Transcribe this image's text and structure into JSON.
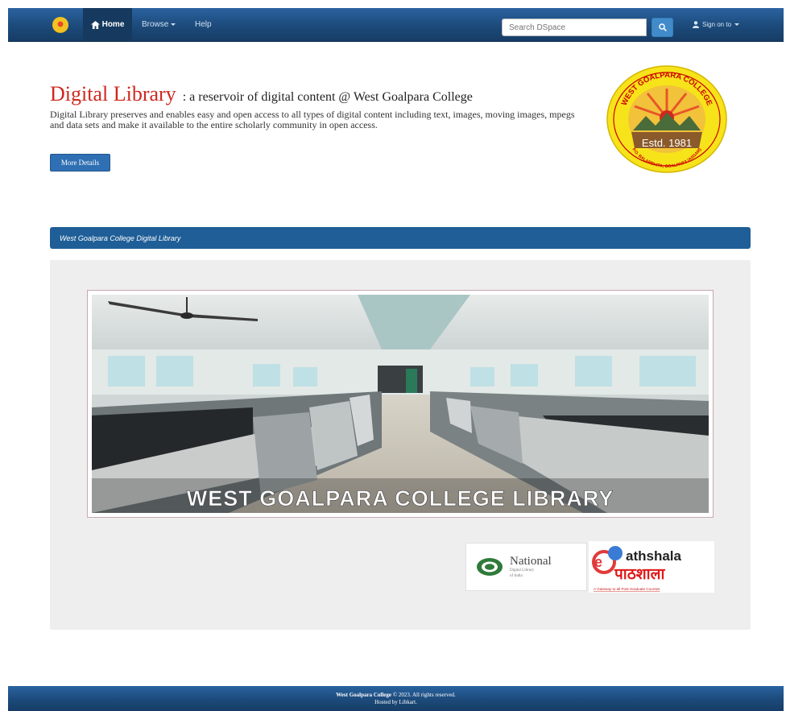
{
  "navbar": {
    "home_label": "Home",
    "browse_label": "Browse",
    "help_label": "Help",
    "search_placeholder": "Search DSpace",
    "login_label": "Sign on to"
  },
  "hero": {
    "title_main": "Digital Library",
    "title_sub": ": a reservoir of digital content @ West Goalpara College",
    "description": "Digital Library preserves and enables easy and open access to all types of digital content including text, images, moving images, mpegs and data sets and make it available to the entire scholarly community in open access.",
    "more_button": "More Details"
  },
  "seal": {
    "top_text": "WEST GOALPARA COLLEGE",
    "bottom_text": "P.O. BALARBHITA, GOALPARA (ASSAM)",
    "established": "Estd. 1981"
  },
  "section": {
    "heading": "West Goalpara College Digital Library"
  },
  "banner": {
    "caption": "WEST GOALPARA COLLEGE LIBRARY"
  },
  "partners": {
    "ndl_name": "National",
    "ndl_sub1": "Digital Library",
    "ndl_sub2": "of India",
    "epg_name": "athshala",
    "epg_hindi": "पाठशाला",
    "epg_tagline": "A Gateway to all Post Graduate Courses"
  },
  "footer": {
    "copyright_name": "West Goalpara College",
    "copyright_rest": " © 2023. All rights reserved.",
    "hosted": "Hosted by Libkart."
  },
  "colors": {
    "navbar": "#1c4a7a",
    "title_red": "#d0281f",
    "section_blue": "#1f5e97",
    "button_blue": "#2f6fb3"
  },
  "icons": [
    "home-icon",
    "search-icon",
    "user-icon",
    "caret-down-icon"
  ]
}
